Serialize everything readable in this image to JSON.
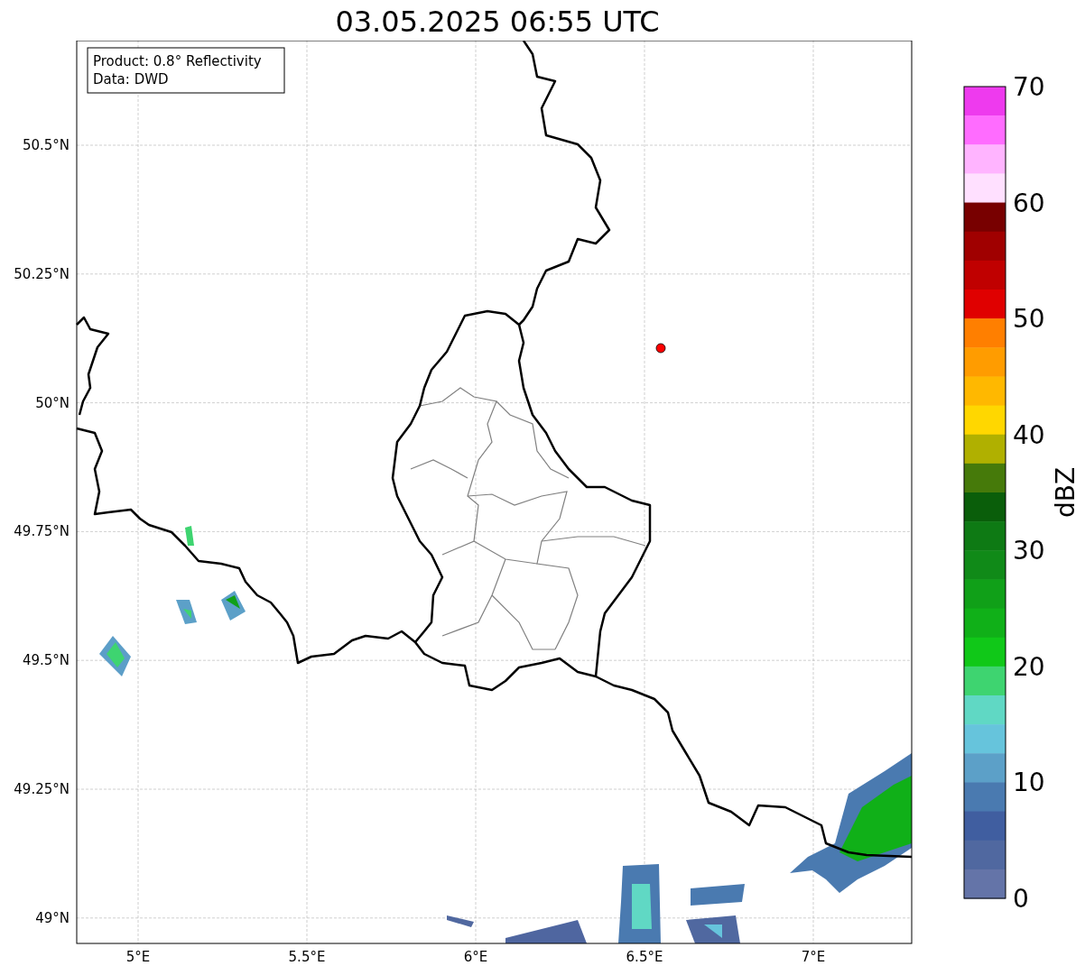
{
  "title": "03.05.2025 06:55 UTC",
  "info_box": [
    "Product: 0.8° Reflectivity",
    "Data: DWD"
  ],
  "lat_ticks": [
    "50.5°N",
    "50.25°N",
    "50°N",
    "49.75°N",
    "49.5°N",
    "49.25°N",
    "49°N"
  ],
  "lon_ticks": [
    "5°E",
    "5.5°E",
    "6°E",
    "6.5°E",
    "7°E"
  ],
  "colorbar": {
    "label": "dBZ",
    "ticks": [
      "70",
      "60",
      "50",
      "40",
      "30",
      "20",
      "10",
      "0"
    ],
    "segments": [
      {
        "color": "#ee3aee"
      },
      {
        "color": "#ff6cff"
      },
      {
        "color": "#ffb4ff"
      },
      {
        "color": "#ffe0ff"
      },
      {
        "color": "#780000"
      },
      {
        "color": "#a00000"
      },
      {
        "color": "#c00000"
      },
      {
        "color": "#e00000"
      },
      {
        "color": "#ff7f00"
      },
      {
        "color": "#ff9c00"
      },
      {
        "color": "#ffb800"
      },
      {
        "color": "#ffd700"
      },
      {
        "color": "#b0b000"
      },
      {
        "color": "#467a0a"
      },
      {
        "color": "#0a5e0a"
      },
      {
        "color": "#0e7a14"
      },
      {
        "color": "#108a18"
      },
      {
        "color": "#10a018"
      },
      {
        "color": "#10b018"
      },
      {
        "color": "#10c818"
      },
      {
        "color": "#3ed470"
      },
      {
        "color": "#60d8c4"
      },
      {
        "color": "#66c4dc"
      },
      {
        "color": "#5ca0c8"
      },
      {
        "color": "#4a7ab0"
      },
      {
        "color": "#405ea0"
      },
      {
        "color": "#5068a0"
      },
      {
        "color": "#6474a8"
      }
    ]
  }
}
